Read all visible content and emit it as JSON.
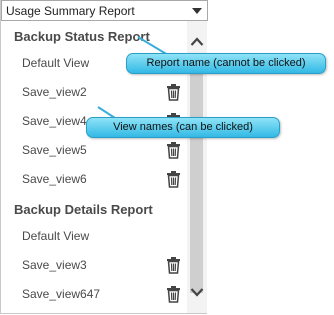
{
  "dropdown": {
    "selected": "Usage Summary Report"
  },
  "groups": [
    {
      "title": "Backup Status Report",
      "items": [
        {
          "label": "Default View",
          "deletable": false
        },
        {
          "label": "Save_view2",
          "deletable": true
        },
        {
          "label": "Save_view4",
          "deletable": true
        },
        {
          "label": "Save_view5",
          "deletable": true
        },
        {
          "label": "Save_view6",
          "deletable": true
        }
      ]
    },
    {
      "title": "Backup Details Report",
      "items": [
        {
          "label": "Default View",
          "deletable": false
        },
        {
          "label": "Save_view3",
          "deletable": true
        },
        {
          "label": "Save_view647",
          "deletable": true
        }
      ]
    }
  ],
  "callouts": {
    "report_name": "Report name (cannot be clicked)",
    "view_names": "View names (can be clicked)"
  },
  "icons": {
    "delete": "trash-icon",
    "scroll_up": "chevron-up-icon",
    "scroll_down": "chevron-down-icon",
    "dropdown": "caret-down-icon"
  },
  "colors": {
    "callout_top": "#8fe3f6",
    "callout_bottom": "#33b9e6",
    "text": "#4a4a4a"
  }
}
